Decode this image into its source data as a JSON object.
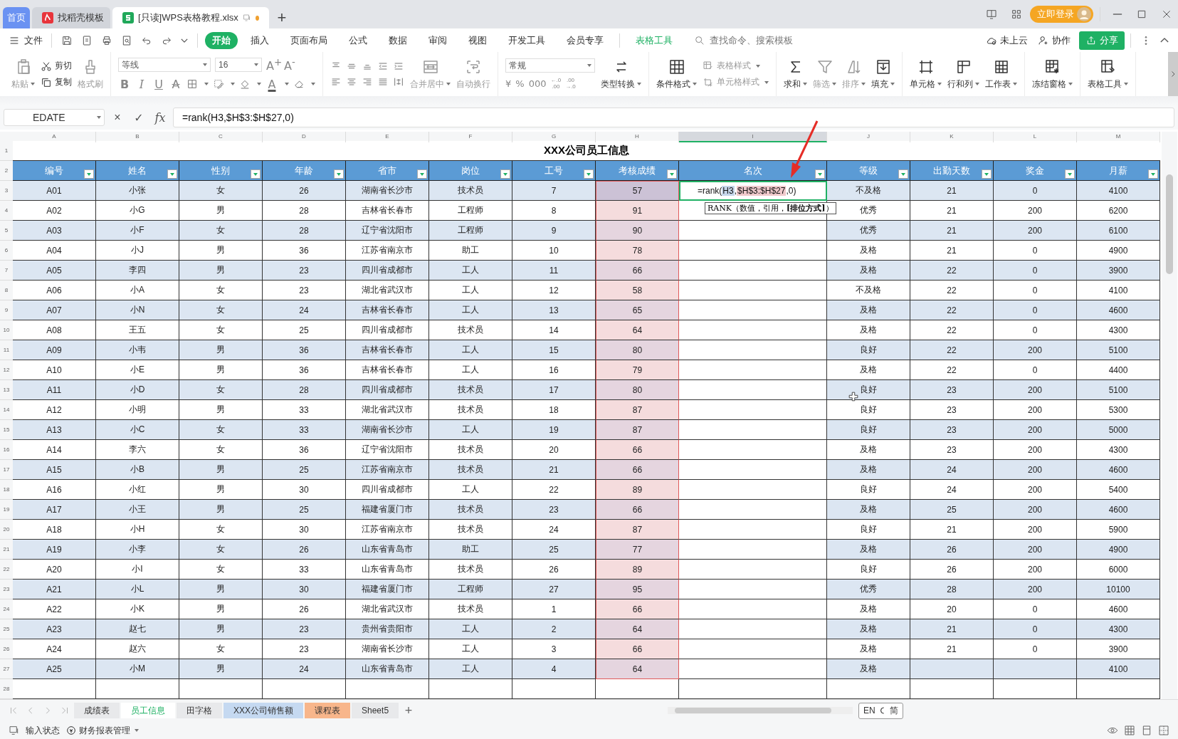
{
  "doc_tabs": [
    {
      "label": "首页",
      "kind": "home",
      "selected": false
    },
    {
      "label": "找稻壳模板",
      "kind": "template",
      "selected": false
    },
    {
      "label": "[只读]WPS表格教程.xlsx",
      "kind": "file",
      "selected": true
    }
  ],
  "new_tab": "+",
  "login_button": "立即登录",
  "file_menu": "文件",
  "menu_tabs": [
    {
      "label": "开始",
      "selected": true,
      "kind": "tab"
    },
    {
      "label": "插入",
      "selected": false,
      "kind": "tab"
    },
    {
      "label": "页面布局",
      "selected": false,
      "kind": "tab"
    },
    {
      "label": "公式",
      "selected": false,
      "kind": "tab"
    },
    {
      "label": "数据",
      "selected": false,
      "kind": "tab"
    },
    {
      "label": "审阅",
      "selected": false,
      "kind": "tab"
    },
    {
      "label": "视图",
      "selected": false,
      "kind": "tab"
    },
    {
      "label": "开发工具",
      "selected": false,
      "kind": "tab"
    },
    {
      "label": "会员专享",
      "selected": false,
      "kind": "tab"
    },
    {
      "label": "表格工具",
      "selected": false,
      "kind": "context"
    }
  ],
  "search": {
    "placeholder": "查找命令、搜索模板"
  },
  "menu_right": {
    "cloud": "未上云",
    "collab": "协作",
    "share": "分享"
  },
  "clipboard": [
    {
      "label": "粘贴",
      "disabled": true
    },
    {
      "label": "剪切",
      "disabled": false
    },
    {
      "label": "复制",
      "disabled": false
    },
    {
      "label": "格式刷",
      "disabled": true
    }
  ],
  "font": {
    "name": "等线",
    "size": "16",
    "size_buttons": [
      "A$^{+}$",
      "A$^{-}$"
    ],
    "style_buttons": [
      "B",
      "I",
      "U",
      "A"
    ],
    "color_button": "A"
  },
  "align_buttons": [
    {
      "label": "合并居中"
    },
    {
      "label": "自动换行"
    }
  ],
  "number": {
    "format": "常规",
    "buttons": [
      "¥",
      "%",
      "000"
    ],
    "decimals": [
      {
        "top": "←.0",
        "bottom": ".00"
      },
      {
        "top": ".00",
        "bottom": "→.0"
      }
    ],
    "convert": "类型转换"
  },
  "tools": [
    {
      "label": "条件格式",
      "kind": "big",
      "disabled": false
    },
    {
      "label": "表格样式",
      "kind": "small",
      "disabled": true
    },
    {
      "label": "单元格样式",
      "kind": "small",
      "disabled": true
    },
    {
      "label": "求和",
      "kind": "big",
      "disabled": false
    },
    {
      "label": "筛选",
      "kind": "big",
      "disabled": true
    },
    {
      "label": "排序",
      "kind": "big",
      "disabled": true
    },
    {
      "label": "填充",
      "kind": "big",
      "disabled": false
    },
    {
      "label": "单元格",
      "kind": "big",
      "disabled": false
    },
    {
      "label": "行和列",
      "kind": "big",
      "disabled": false
    },
    {
      "label": "工作表",
      "kind": "big",
      "disabled": false
    },
    {
      "label": "冻结窗格",
      "kind": "big",
      "disabled": false
    },
    {
      "label": "表格工具",
      "kind": "big",
      "disabled": false
    }
  ],
  "formula_bar": {
    "name_box": "EDATE",
    "buttons": [
      "×",
      "✓",
      "fx"
    ],
    "value": "=rank(H3,$H$3:$H$27,0)"
  },
  "sheet": {
    "columns": [
      {
        "letter": "A",
        "header": "编号",
        "selected": false
      },
      {
        "letter": "B",
        "header": "姓名",
        "selected": false
      },
      {
        "letter": "C",
        "header": "性别",
        "selected": false
      },
      {
        "letter": "D",
        "header": "年龄",
        "selected": false
      },
      {
        "letter": "E",
        "header": "省市",
        "selected": false
      },
      {
        "letter": "F",
        "header": "岗位",
        "selected": false
      },
      {
        "letter": "G",
        "header": "工号",
        "selected": false
      },
      {
        "letter": "H",
        "header": "考核成绩",
        "selected": false
      },
      {
        "letter": "I",
        "header": "名次",
        "selected": true
      },
      {
        "letter": "J",
        "header": "等级",
        "selected": false
      },
      {
        "letter": "K",
        "header": "出勤天数",
        "selected": false
      },
      {
        "letter": "L",
        "header": "奖金",
        "selected": false
      },
      {
        "letter": "M",
        "header": "月薪",
        "selected": false
      }
    ],
    "title_row": {
      "num": "1",
      "title": "XXX公司员工信息"
    },
    "header_row": {
      "num": "2"
    },
    "rows": [
      {
        "num": "3",
        "cells": [
          "A01",
          "小张",
          "女",
          "26",
          "湖南省长沙市",
          "技术员",
          "7",
          "57",
          "",
          "不及格",
          "21",
          "0",
          "4100"
        ],
        "editor": {
          "parts": [
            {
              "text": "=rank(",
              "kind": "text"
            },
            {
              "text": "H3",
              "kind": "ref",
              "color": "#c5d5ea"
            },
            {
              "text": ",",
              "kind": "text"
            },
            {
              "text": "$H$3:$H$27",
              "kind": "ref",
              "color": "#f0c9cc"
            },
            {
              "text": ",0)",
              "kind": "text"
            }
          ],
          "tooltip": "RANK（数值，引用，**[排位方式]**）"
        }
      },
      {
        "num": "4",
        "cells": [
          "A02",
          "小G",
          "男",
          "28",
          "吉林省长春市",
          "工程师",
          "8",
          "91",
          "",
          "优秀",
          "21",
          "200",
          "6200"
        ]
      },
      {
        "num": "5",
        "cells": [
          "A03",
          "小F",
          "女",
          "28",
          "辽宁省沈阳市",
          "工程师",
          "9",
          "90",
          "",
          "优秀",
          "21",
          "200",
          "6100"
        ]
      },
      {
        "num": "6",
        "cells": [
          "A04",
          "小J",
          "男",
          "36",
          "江苏省南京市",
          "助工",
          "10",
          "78",
          "",
          "及格",
          "21",
          "0",
          "4900"
        ]
      },
      {
        "num": "7",
        "cells": [
          "A05",
          "李四",
          "男",
          "23",
          "四川省成都市",
          "工人",
          "11",
          "66",
          "",
          "及格",
          "22",
          "0",
          "3900"
        ]
      },
      {
        "num": "8",
        "cells": [
          "A06",
          "小A",
          "女",
          "23",
          "湖北省武汉市",
          "工人",
          "12",
          "58",
          "",
          "不及格",
          "22",
          "0",
          "4100"
        ]
      },
      {
        "num": "9",
        "cells": [
          "A07",
          "小N",
          "女",
          "24",
          "吉林省长春市",
          "工人",
          "13",
          "65",
          "",
          "及格",
          "22",
          "0",
          "4600"
        ]
      },
      {
        "num": "10",
        "cells": [
          "A08",
          "王五",
          "女",
          "25",
          "四川省成都市",
          "技术员",
          "14",
          "64",
          "",
          "及格",
          "22",
          "0",
          "4300"
        ]
      },
      {
        "num": "11",
        "cells": [
          "A09",
          "小韦",
          "男",
          "36",
          "吉林省长春市",
          "工人",
          "15",
          "80",
          "",
          "良好",
          "22",
          "200",
          "5100"
        ]
      },
      {
        "num": "12",
        "cells": [
          "A10",
          "小E",
          "男",
          "36",
          "吉林省长春市",
          "工人",
          "16",
          "79",
          "",
          "及格",
          "22",
          "0",
          "4400"
        ]
      },
      {
        "num": "13",
        "cells": [
          "A11",
          "小D",
          "女",
          "28",
          "四川省成都市",
          "技术员",
          "17",
          "80",
          "",
          "良好",
          "23",
          "200",
          "5100"
        ]
      },
      {
        "num": "14",
        "cells": [
          "A12",
          "小明",
          "男",
          "33",
          "湖北省武汉市",
          "技术员",
          "18",
          "87",
          "",
          "良好",
          "23",
          "200",
          "5300"
        ]
      },
      {
        "num": "15",
        "cells": [
          "A13",
          "小C",
          "女",
          "33",
          "湖南省长沙市",
          "工人",
          "19",
          "87",
          "",
          "良好",
          "23",
          "200",
          "5000"
        ]
      },
      {
        "num": "16",
        "cells": [
          "A14",
          "李六",
          "女",
          "36",
          "辽宁省沈阳市",
          "技术员",
          "20",
          "66",
          "",
          "及格",
          "23",
          "200",
          "4300"
        ]
      },
      {
        "num": "17",
        "cells": [
          "A15",
          "小B",
          "男",
          "25",
          "江苏省南京市",
          "技术员",
          "21",
          "66",
          "",
          "及格",
          "24",
          "200",
          "4600"
        ]
      },
      {
        "num": "18",
        "cells": [
          "A16",
          "小红",
          "男",
          "30",
          "四川省成都市",
          "工人",
          "22",
          "89",
          "",
          "良好",
          "24",
          "200",
          "5400"
        ]
      },
      {
        "num": "19",
        "cells": [
          "A17",
          "小王",
          "男",
          "25",
          "福建省厦门市",
          "技术员",
          "23",
          "66",
          "",
          "及格",
          "25",
          "200",
          "4600"
        ]
      },
      {
        "num": "20",
        "cells": [
          "A18",
          "小H",
          "女",
          "30",
          "江苏省南京市",
          "技术员",
          "24",
          "87",
          "",
          "良好",
          "21",
          "200",
          "5900"
        ]
      },
      {
        "num": "21",
        "cells": [
          "A19",
          "小李",
          "女",
          "26",
          "山东省青岛市",
          "助工",
          "25",
          "77",
          "",
          "及格",
          "26",
          "200",
          "4900"
        ]
      },
      {
        "num": "22",
        "cells": [
          "A20",
          "小I",
          "女",
          "33",
          "山东省青岛市",
          "技术员",
          "26",
          "89",
          "",
          "良好",
          "26",
          "200",
          "6000"
        ]
      },
      {
        "num": "23",
        "cells": [
          "A21",
          "小L",
          "男",
          "30",
          "福建省厦门市",
          "工程师",
          "27",
          "95",
          "",
          "优秀",
          "28",
          "200",
          "10100"
        ]
      },
      {
        "num": "24",
        "cells": [
          "A22",
          "小K",
          "男",
          "26",
          "湖北省武汉市",
          "技术员",
          "1",
          "66",
          "",
          "及格",
          "20",
          "0",
          "4600"
        ]
      },
      {
        "num": "25",
        "cells": [
          "A23",
          "赵七",
          "男",
          "23",
          "贵州省贵阳市",
          "工人",
          "2",
          "64",
          "",
          "及格",
          "21",
          "0",
          "4300"
        ]
      },
      {
        "num": "26",
        "cells": [
          "A24",
          "赵六",
          "女",
          "23",
          "湖南省长沙市",
          "工人",
          "3",
          "66",
          "",
          "及格",
          "21",
          "0",
          "3900"
        ]
      },
      {
        "num": "27",
        "cells": [
          "A25",
          "小M",
          "男",
          "24",
          "山东省青岛市",
          "工人",
          "4",
          "64",
          "",
          "及格",
          "",
          "",
          "4100"
        ]
      }
    ],
    "empty_rows": [
      {
        "num": "28"
      }
    ]
  },
  "sheet_tabs": [
    {
      "label": "成绩表",
      "selected": false
    },
    {
      "label": "员工信息",
      "selected": true
    },
    {
      "label": "田字格",
      "selected": false
    },
    {
      "label": "XXX公司销售额",
      "selected": false,
      "color": "#c5d9f1"
    },
    {
      "label": "课程表",
      "selected": false,
      "color": "#f8b68b"
    },
    {
      "label": "Sheet5",
      "selected": false
    }
  ],
  "add_sheet": "+",
  "ime": {
    "lang": "EN",
    "mode": "简"
  },
  "status_bar": {
    "input_state": "输入状态",
    "report": "财务报表管理"
  }
}
